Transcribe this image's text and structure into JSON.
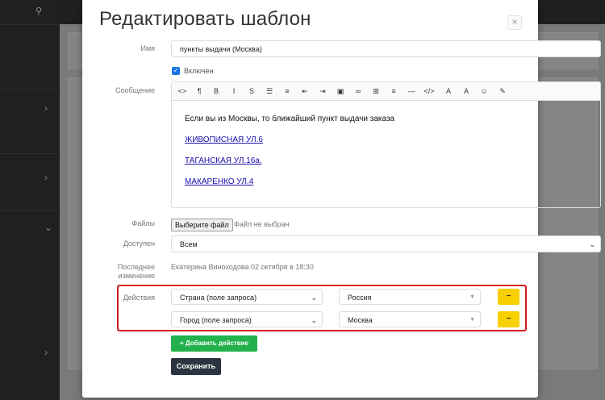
{
  "background": {
    "search_icon": "search-icon"
  },
  "modal": {
    "title": "Редактировать шаблон",
    "close_label": "×",
    "name_label": "Имя",
    "name_value": "пункты выдачи (Москва)",
    "enabled_label": "Включен",
    "enabled_checked": true,
    "message_label": "Сообщение",
    "toolbar": [
      {
        "icon": "code-view-icon",
        "glyph": "<>"
      },
      {
        "icon": "paragraph-icon",
        "glyph": "¶"
      },
      {
        "icon": "bold-icon",
        "glyph": "B"
      },
      {
        "icon": "italic-icon",
        "glyph": "I"
      },
      {
        "icon": "strikethrough-icon",
        "glyph": "S"
      },
      {
        "icon": "bullet-list-icon",
        "glyph": "☰"
      },
      {
        "icon": "numbered-list-icon",
        "glyph": "≡"
      },
      {
        "icon": "outdent-icon",
        "glyph": "⇤"
      },
      {
        "icon": "indent-icon",
        "glyph": "⇥"
      },
      {
        "icon": "image-icon",
        "glyph": "▣"
      },
      {
        "icon": "link-icon",
        "glyph": "∞"
      },
      {
        "icon": "table-icon",
        "glyph": "⊞"
      },
      {
        "icon": "align-icon",
        "glyph": "≡"
      },
      {
        "icon": "horizontal-rule-icon",
        "glyph": "—"
      },
      {
        "icon": "code-icon",
        "glyph": "</>"
      },
      {
        "icon": "font-color-icon",
        "glyph": "A"
      },
      {
        "icon": "background-color-icon",
        "glyph": "A"
      },
      {
        "icon": "emoji-icon",
        "glyph": "☺"
      },
      {
        "icon": "attachment-icon",
        "glyph": "✎"
      }
    ],
    "message_text": "Если вы из Москвы, то ближайший пункт выдачи заказа",
    "message_links": [
      "ЖИВОПИСНАЯ УЛ.6",
      "ТАГАНСКАЯ УЛ.16а.",
      "МАКАРЕНКО УЛ.4"
    ],
    "files_label": "Файлы",
    "file_button": "Выберите файл",
    "file_status": "Файл не выбран",
    "available_label": "Доступен",
    "available_value": "Всем",
    "last_changed_label_1": "Последнее",
    "last_changed_label_2": "изменение",
    "last_changed_value": "Екатерина Виноходова 02 октября в 18:30",
    "actions_label": "Действия",
    "actions": [
      {
        "field": "Страна (поле запроса)",
        "value": "Россия",
        "remove": "−"
      },
      {
        "field": "Город (поле запроса)",
        "value": "Москва",
        "remove": "−"
      }
    ],
    "add_action_label": "Добавить действие",
    "add_action_icon": "+",
    "save_label": "Сохранить"
  },
  "colors": {
    "highlight": "#d21e1e",
    "add_button": "#22b14c",
    "remove_button": "#f7d000",
    "save_button": "#2b3440",
    "link": "#1a0dab"
  }
}
